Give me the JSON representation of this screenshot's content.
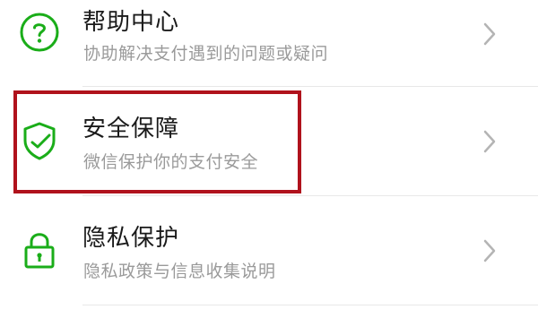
{
  "colors": {
    "icon_green": "#1aad19",
    "highlight_red": "#b0121c",
    "title_text": "#1a1a1a",
    "subtitle_text": "#9a9a9a"
  },
  "items": [
    {
      "icon": "question-circle-icon",
      "title": "帮助中心",
      "subtitle": "协助解决支付遇到的问题或疑问"
    },
    {
      "icon": "shield-check-icon",
      "title": "安全保障",
      "subtitle": "微信保护你的支付安全"
    },
    {
      "icon": "lock-icon",
      "title": "隐私保护",
      "subtitle": "隐私政策与信息收集说明"
    }
  ]
}
